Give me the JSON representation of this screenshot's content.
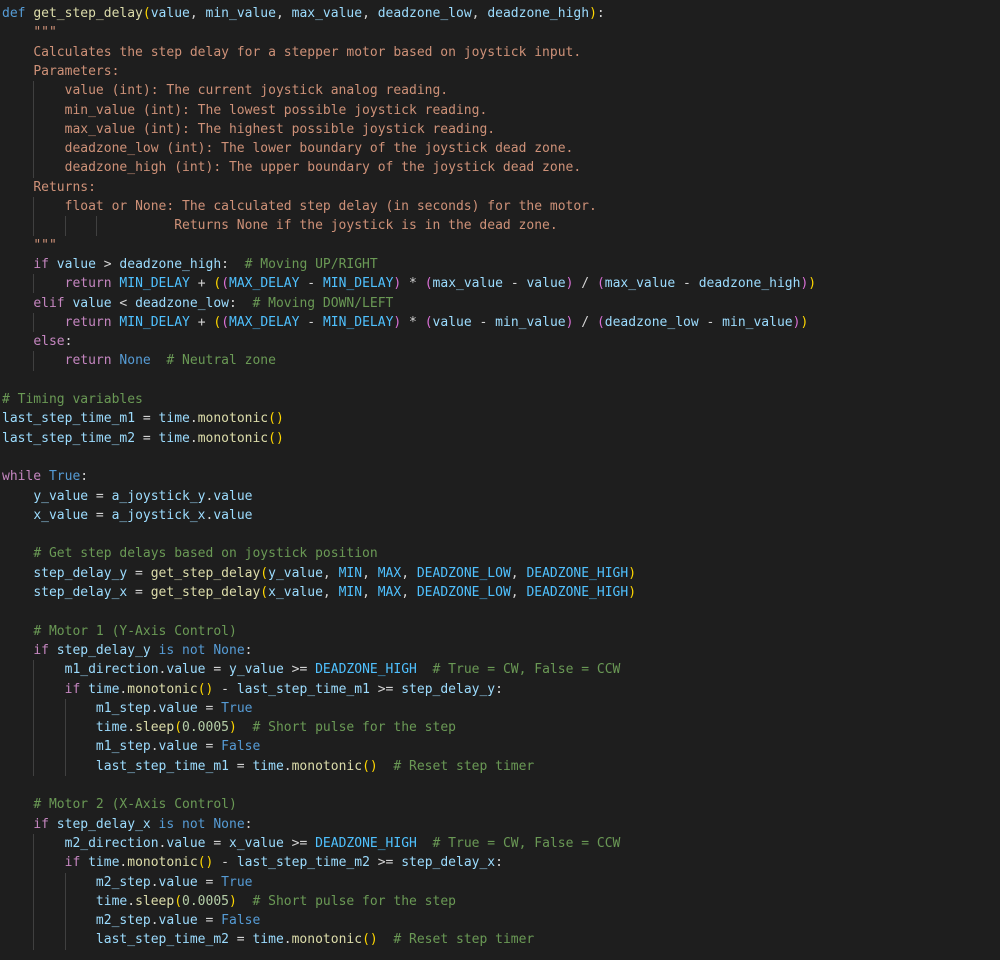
{
  "editor": {
    "background": "#1e1e1e",
    "lines": [
      [
        [
          "kw",
          "def "
        ],
        [
          "fn",
          "get_step_delay"
        ],
        [
          "br",
          "("
        ],
        [
          "var",
          "value"
        ],
        [
          "op",
          ", "
        ],
        [
          "var",
          "min_value"
        ],
        [
          "op",
          ", "
        ],
        [
          "var",
          "max_value"
        ],
        [
          "op",
          ", "
        ],
        [
          "var",
          "deadzone_low"
        ],
        [
          "op",
          ", "
        ],
        [
          "var",
          "deadzone_high"
        ],
        [
          "br",
          ")"
        ],
        [
          "op",
          ":"
        ]
      ],
      [
        [
          "op",
          "    "
        ],
        [
          "str",
          "\"\"\""
        ]
      ],
      [
        [
          "op",
          "    "
        ],
        [
          "str",
          "Calculates the step delay for a stepper motor based on joystick input."
        ]
      ],
      [
        [
          "op",
          "    "
        ],
        [
          "str",
          "Parameters:"
        ]
      ],
      [
        [
          "op",
          "        "
        ],
        [
          "str",
          "value (int): The current joystick analog reading."
        ]
      ],
      [
        [
          "op",
          "        "
        ],
        [
          "str",
          "min_value (int): The lowest possible joystick reading."
        ]
      ],
      [
        [
          "op",
          "        "
        ],
        [
          "str",
          "max_value (int): The highest possible joystick reading."
        ]
      ],
      [
        [
          "op",
          "        "
        ],
        [
          "str",
          "deadzone_low (int): The lower boundary of the joystick dead zone."
        ]
      ],
      [
        [
          "op",
          "        "
        ],
        [
          "str",
          "deadzone_high (int): The upper boundary of the joystick dead zone."
        ]
      ],
      [
        [
          "op",
          "    "
        ],
        [
          "str",
          "Returns:"
        ]
      ],
      [
        [
          "op",
          "        "
        ],
        [
          "str",
          "float or None: The calculated step delay (in seconds) for the motor."
        ]
      ],
      [
        [
          "op",
          "                      "
        ],
        [
          "str",
          "Returns None if the joystick is in the dead zone."
        ]
      ],
      [
        [
          "op",
          "    "
        ],
        [
          "str",
          "\"\"\""
        ]
      ],
      [
        [
          "op",
          "    "
        ],
        [
          "kw2",
          "if "
        ],
        [
          "var",
          "value"
        ],
        [
          "op",
          " > "
        ],
        [
          "var",
          "deadzone_high"
        ],
        [
          "op",
          ":  "
        ],
        [
          "com",
          "# Moving UP/RIGHT"
        ]
      ],
      [
        [
          "op",
          "        "
        ],
        [
          "kw2",
          "return "
        ],
        [
          "con",
          "MIN_DELAY"
        ],
        [
          "op",
          " + "
        ],
        [
          "br",
          "("
        ],
        [
          "br2",
          "("
        ],
        [
          "con",
          "MAX_DELAY"
        ],
        [
          "op",
          " - "
        ],
        [
          "con",
          "MIN_DELAY"
        ],
        [
          "br2",
          ")"
        ],
        [
          "op",
          " * "
        ],
        [
          "br2",
          "("
        ],
        [
          "var",
          "max_value"
        ],
        [
          "op",
          " - "
        ],
        [
          "var",
          "value"
        ],
        [
          "br2",
          ")"
        ],
        [
          "op",
          " / "
        ],
        [
          "br2",
          "("
        ],
        [
          "var",
          "max_value"
        ],
        [
          "op",
          " - "
        ],
        [
          "var",
          "deadzone_high"
        ],
        [
          "br2",
          ")"
        ],
        [
          "br",
          ")"
        ]
      ],
      [
        [
          "op",
          "    "
        ],
        [
          "kw2",
          "elif "
        ],
        [
          "var",
          "value"
        ],
        [
          "op",
          " < "
        ],
        [
          "var",
          "deadzone_low"
        ],
        [
          "op",
          ":  "
        ],
        [
          "com",
          "# Moving DOWN/LEFT"
        ]
      ],
      [
        [
          "op",
          "        "
        ],
        [
          "kw2",
          "return "
        ],
        [
          "con",
          "MIN_DELAY"
        ],
        [
          "op",
          " + "
        ],
        [
          "br",
          "("
        ],
        [
          "br2",
          "("
        ],
        [
          "con",
          "MAX_DELAY"
        ],
        [
          "op",
          " - "
        ],
        [
          "con",
          "MIN_DELAY"
        ],
        [
          "br2",
          ")"
        ],
        [
          "op",
          " * "
        ],
        [
          "br2",
          "("
        ],
        [
          "var",
          "value"
        ],
        [
          "op",
          " - "
        ],
        [
          "var",
          "min_value"
        ],
        [
          "br2",
          ")"
        ],
        [
          "op",
          " / "
        ],
        [
          "br2",
          "("
        ],
        [
          "var",
          "deadzone_low"
        ],
        [
          "op",
          " - "
        ],
        [
          "var",
          "min_value"
        ],
        [
          "br2",
          ")"
        ],
        [
          "br",
          ")"
        ]
      ],
      [
        [
          "op",
          "    "
        ],
        [
          "kw2",
          "else"
        ],
        [
          "op",
          ":"
        ]
      ],
      [
        [
          "op",
          "        "
        ],
        [
          "kw2",
          "return "
        ],
        [
          "kw",
          "None"
        ],
        [
          "op",
          "  "
        ],
        [
          "com",
          "# Neutral zone"
        ]
      ],
      [],
      [
        [
          "com",
          "# Timing variables"
        ]
      ],
      [
        [
          "var",
          "last_step_time_m1"
        ],
        [
          "op",
          " = "
        ],
        [
          "var",
          "time"
        ],
        [
          "op",
          "."
        ],
        [
          "fn",
          "monotonic"
        ],
        [
          "br",
          "()"
        ]
      ],
      [
        [
          "var",
          "last_step_time_m2"
        ],
        [
          "op",
          " = "
        ],
        [
          "var",
          "time"
        ],
        [
          "op",
          "."
        ],
        [
          "fn",
          "monotonic"
        ],
        [
          "br",
          "()"
        ]
      ],
      [],
      [
        [
          "kw2",
          "while "
        ],
        [
          "kw",
          "True"
        ],
        [
          "op",
          ":"
        ]
      ],
      [
        [
          "op",
          "    "
        ],
        [
          "var",
          "y_value"
        ],
        [
          "op",
          " = "
        ],
        [
          "var",
          "a_joystick_y"
        ],
        [
          "op",
          "."
        ],
        [
          "var",
          "value"
        ]
      ],
      [
        [
          "op",
          "    "
        ],
        [
          "var",
          "x_value"
        ],
        [
          "op",
          " = "
        ],
        [
          "var",
          "a_joystick_x"
        ],
        [
          "op",
          "."
        ],
        [
          "var",
          "value"
        ]
      ],
      [],
      [
        [
          "op",
          "    "
        ],
        [
          "com",
          "# Get step delays based on joystick position"
        ]
      ],
      [
        [
          "op",
          "    "
        ],
        [
          "var",
          "step_delay_y"
        ],
        [
          "op",
          " = "
        ],
        [
          "fn",
          "get_step_delay"
        ],
        [
          "br",
          "("
        ],
        [
          "var",
          "y_value"
        ],
        [
          "op",
          ", "
        ],
        [
          "con",
          "MIN"
        ],
        [
          "op",
          ", "
        ],
        [
          "con",
          "MAX"
        ],
        [
          "op",
          ", "
        ],
        [
          "con",
          "DEADZONE_LOW"
        ],
        [
          "op",
          ", "
        ],
        [
          "con",
          "DEADZONE_HIGH"
        ],
        [
          "br",
          ")"
        ]
      ],
      [
        [
          "op",
          "    "
        ],
        [
          "var",
          "step_delay_x"
        ],
        [
          "op",
          " = "
        ],
        [
          "fn",
          "get_step_delay"
        ],
        [
          "br",
          "("
        ],
        [
          "var",
          "x_value"
        ],
        [
          "op",
          ", "
        ],
        [
          "con",
          "MIN"
        ],
        [
          "op",
          ", "
        ],
        [
          "con",
          "MAX"
        ],
        [
          "op",
          ", "
        ],
        [
          "con",
          "DEADZONE_LOW"
        ],
        [
          "op",
          ", "
        ],
        [
          "con",
          "DEADZONE_HIGH"
        ],
        [
          "br",
          ")"
        ]
      ],
      [],
      [
        [
          "op",
          "    "
        ],
        [
          "com",
          "# Motor 1 (Y-Axis Control)"
        ]
      ],
      [
        [
          "op",
          "    "
        ],
        [
          "kw2",
          "if "
        ],
        [
          "var",
          "step_delay_y"
        ],
        [
          "kw",
          " is not "
        ],
        [
          "kw",
          "None"
        ],
        [
          "op",
          ":"
        ]
      ],
      [
        [
          "op",
          "        "
        ],
        [
          "var",
          "m1_direction"
        ],
        [
          "op",
          "."
        ],
        [
          "var",
          "value"
        ],
        [
          "op",
          " = "
        ],
        [
          "var",
          "y_value"
        ],
        [
          "op",
          " >= "
        ],
        [
          "con",
          "DEADZONE_HIGH"
        ],
        [
          "op",
          "  "
        ],
        [
          "com",
          "# True = CW, False = CCW"
        ]
      ],
      [
        [
          "op",
          "        "
        ],
        [
          "kw2",
          "if "
        ],
        [
          "var",
          "time"
        ],
        [
          "op",
          "."
        ],
        [
          "fn",
          "monotonic"
        ],
        [
          "br",
          "()"
        ],
        [
          "op",
          " - "
        ],
        [
          "var",
          "last_step_time_m1"
        ],
        [
          "op",
          " >= "
        ],
        [
          "var",
          "step_delay_y"
        ],
        [
          "op",
          ":"
        ]
      ],
      [
        [
          "op",
          "            "
        ],
        [
          "var",
          "m1_step"
        ],
        [
          "op",
          "."
        ],
        [
          "var",
          "value"
        ],
        [
          "op",
          " = "
        ],
        [
          "kw",
          "True"
        ]
      ],
      [
        [
          "op",
          "            "
        ],
        [
          "var",
          "time"
        ],
        [
          "op",
          "."
        ],
        [
          "fn",
          "sleep"
        ],
        [
          "br",
          "("
        ],
        [
          "num",
          "0.0005"
        ],
        [
          "br",
          ")"
        ],
        [
          "op",
          "  "
        ],
        [
          "com",
          "# Short pulse for the step"
        ]
      ],
      [
        [
          "op",
          "            "
        ],
        [
          "var",
          "m1_step"
        ],
        [
          "op",
          "."
        ],
        [
          "var",
          "value"
        ],
        [
          "op",
          " = "
        ],
        [
          "kw",
          "False"
        ]
      ],
      [
        [
          "op",
          "            "
        ],
        [
          "var",
          "last_step_time_m1"
        ],
        [
          "op",
          " = "
        ],
        [
          "var",
          "time"
        ],
        [
          "op",
          "."
        ],
        [
          "fn",
          "monotonic"
        ],
        [
          "br",
          "()"
        ],
        [
          "op",
          "  "
        ],
        [
          "com",
          "# Reset step timer"
        ]
      ],
      [],
      [
        [
          "op",
          "    "
        ],
        [
          "com",
          "# Motor 2 (X-Axis Control)"
        ]
      ],
      [
        [
          "op",
          "    "
        ],
        [
          "kw2",
          "if "
        ],
        [
          "var",
          "step_delay_x"
        ],
        [
          "kw",
          " is not "
        ],
        [
          "kw",
          "None"
        ],
        [
          "op",
          ":"
        ]
      ],
      [
        [
          "op",
          "        "
        ],
        [
          "var",
          "m2_direction"
        ],
        [
          "op",
          "."
        ],
        [
          "var",
          "value"
        ],
        [
          "op",
          " = "
        ],
        [
          "var",
          "x_value"
        ],
        [
          "op",
          " >= "
        ],
        [
          "con",
          "DEADZONE_HIGH"
        ],
        [
          "op",
          "  "
        ],
        [
          "com",
          "# True = CW, False = CCW"
        ]
      ],
      [
        [
          "op",
          "        "
        ],
        [
          "kw2",
          "if "
        ],
        [
          "var",
          "time"
        ],
        [
          "op",
          "."
        ],
        [
          "fn",
          "monotonic"
        ],
        [
          "br",
          "()"
        ],
        [
          "op",
          " - "
        ],
        [
          "var",
          "last_step_time_m2"
        ],
        [
          "op",
          " >= "
        ],
        [
          "var",
          "step_delay_x"
        ],
        [
          "op",
          ":"
        ]
      ],
      [
        [
          "op",
          "            "
        ],
        [
          "var",
          "m2_step"
        ],
        [
          "op",
          "."
        ],
        [
          "var",
          "value"
        ],
        [
          "op",
          " = "
        ],
        [
          "kw",
          "True"
        ]
      ],
      [
        [
          "op",
          "            "
        ],
        [
          "var",
          "time"
        ],
        [
          "op",
          "."
        ],
        [
          "fn",
          "sleep"
        ],
        [
          "br",
          "("
        ],
        [
          "num",
          "0.0005"
        ],
        [
          "br",
          ")"
        ],
        [
          "op",
          "  "
        ],
        [
          "com",
          "# Short pulse for the step"
        ]
      ],
      [
        [
          "op",
          "            "
        ],
        [
          "var",
          "m2_step"
        ],
        [
          "op",
          "."
        ],
        [
          "var",
          "value"
        ],
        [
          "op",
          " = "
        ],
        [
          "kw",
          "False"
        ]
      ],
      [
        [
          "op",
          "            "
        ],
        [
          "var",
          "last_step_time_m2"
        ],
        [
          "op",
          " = "
        ],
        [
          "var",
          "time"
        ],
        [
          "op",
          "."
        ],
        [
          "fn",
          "monotonic"
        ],
        [
          "br",
          "()"
        ],
        [
          "op",
          "  "
        ],
        [
          "com",
          "# Reset step timer"
        ]
      ]
    ]
  }
}
